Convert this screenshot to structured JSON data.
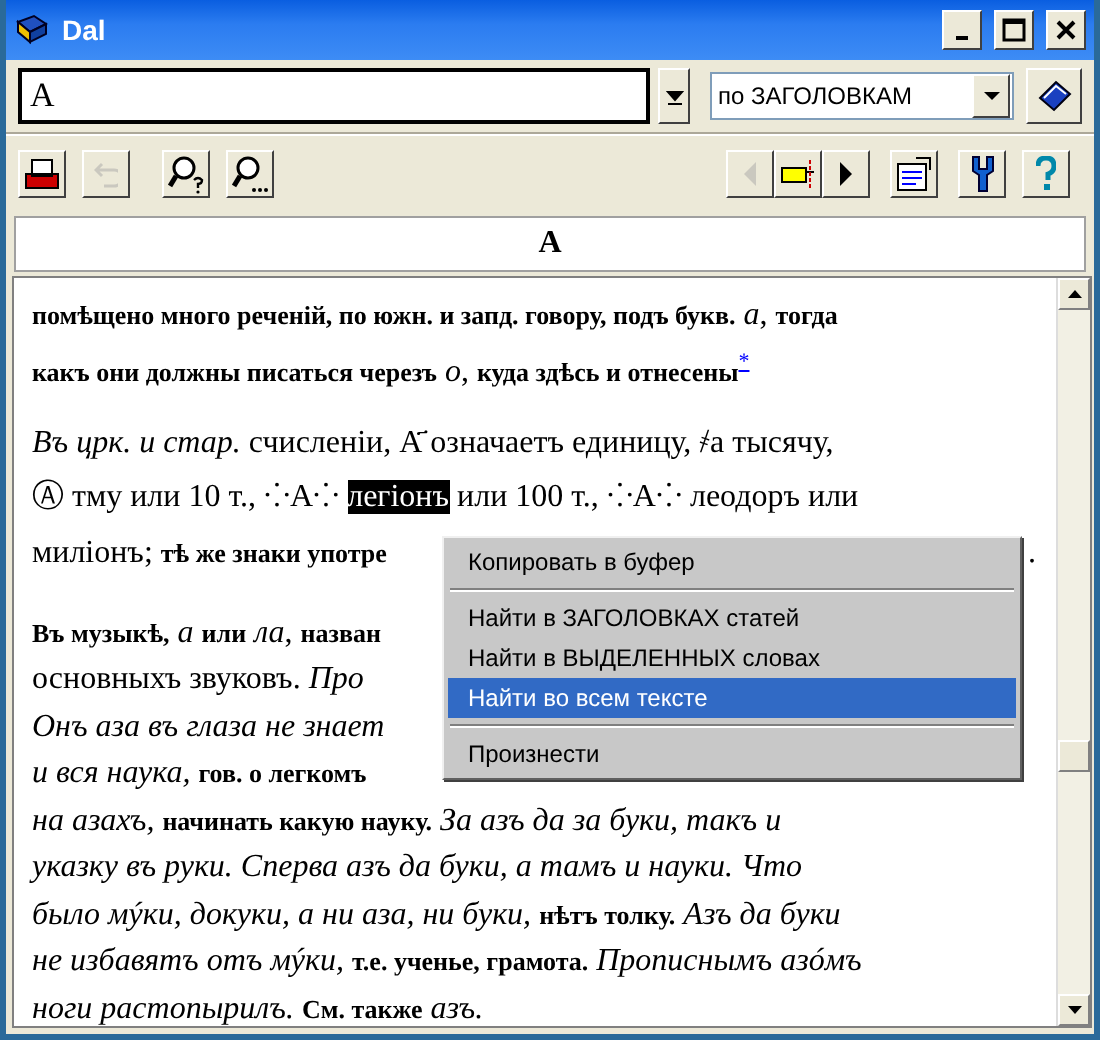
{
  "window": {
    "title": "Dal"
  },
  "search": {
    "value": "А",
    "mode": "по ЗАГОЛОВКАМ"
  },
  "toolbar": [
    {
      "kind": "print",
      "disabled": false
    },
    {
      "kind": "undo",
      "disabled": true
    },
    {
      "kind": "find-help",
      "disabled": false
    },
    {
      "kind": "find-more",
      "disabled": false
    },
    {
      "kind": "back",
      "disabled": true
    },
    {
      "kind": "pointer",
      "disabled": false
    },
    {
      "kind": "forward",
      "disabled": false
    },
    {
      "kind": "properties",
      "disabled": false
    },
    {
      "kind": "tools",
      "disabled": false
    },
    {
      "kind": "help",
      "disabled": false
    }
  ],
  "heading": "А",
  "paragraphs": [
    [
      {
        "text": "**помѣщено много реченій, по южн. и запд. говору, подъ букв.** *а*, **тогда**"
      },
      {
        "text": "**какъ они должны писаться черезъ** *о*, **куда здѣсь и отнесены**",
        "link": "*"
      }
    ],
    [
      {
        "text": "*Въ црк. и стар.* счисленіи, А҃ означаетъ единицу, ҂а  тысячу,"
      },
      {
        "text": "Ⓐ тму или 10 т., ⁘А⁘",
        "highlight": "легіонъ",
        "after": "или 100 т., ⁘А⁘ леодоръ или"
      },
      {
        "text": "милiонъ; **тѣ же знаки употре**",
        "tail": "."
      }
    ],
    [
      {
        "text": "**Въ музыкѣ,** *а* **или** *ла*, **назван**"
      },
      {
        "text": "основныхъ звуковъ. *Про*"
      },
      {
        "text": "*Онъ аза въ глаза не знает*"
      },
      {
        "text": "*и вся наука,* **гов. о легкомъ**"
      },
      {
        "text": "*на азахъ,* **начинать какую науку.** *За азъ да за буки, такъ и*"
      },
      {
        "text": "*указку въ руки. Сперва азъ да буки, а тамъ и науки. Что*"
      },
      {
        "text": "*было мýки, докуки, а ни аза, ни буки,* **нѣтъ толку.** *Азъ да буки*"
      },
      {
        "text": "*не избавятъ отъ мýки,* **т.е. ученье, грамота.** *Прописнымъ азóмъ*"
      },
      {
        "text": "*ноги растопырилъ.* **См. также** *азъ.*"
      }
    ]
  ],
  "context_menu": [
    {
      "kind": "item",
      "label": "Копировать в буфер",
      "selected": false
    },
    {
      "kind": "separator"
    },
    {
      "kind": "item",
      "label": "Найти в ЗАГОЛОВКАХ статей",
      "selected": false
    },
    {
      "kind": "item",
      "label": "Найти в ВЫДЕЛЕННЫХ словах",
      "selected": false
    },
    {
      "kind": "item",
      "label": "Найти во всем тексте",
      "selected": true
    },
    {
      "kind": "separator"
    },
    {
      "kind": "item",
      "label": "Произнести",
      "selected": false
    }
  ]
}
